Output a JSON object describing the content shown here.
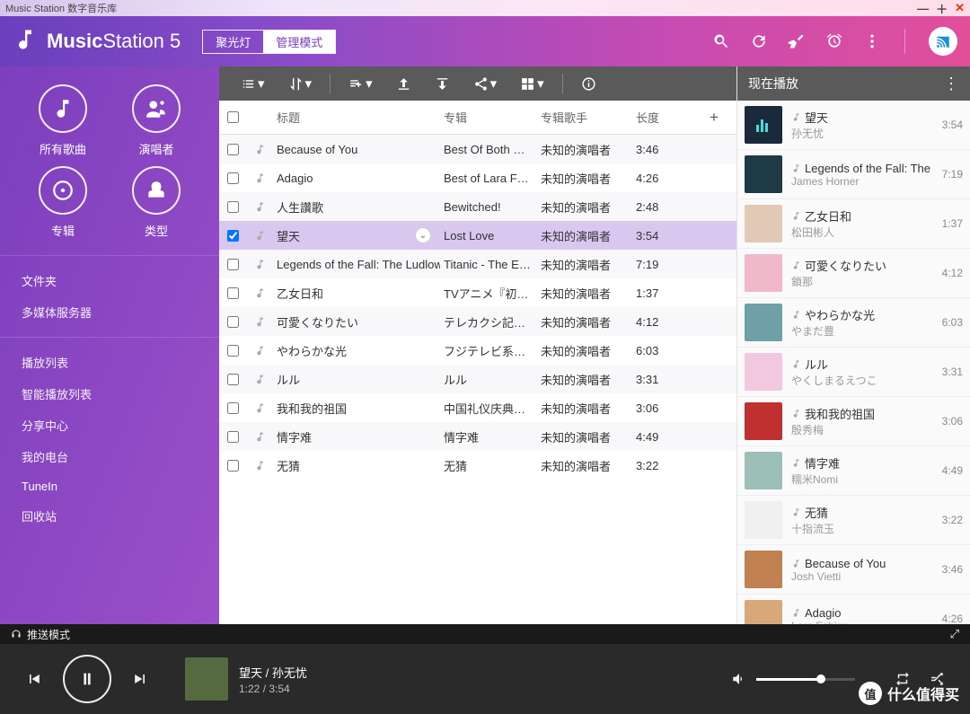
{
  "window": {
    "title": "Music Station 数字音乐库"
  },
  "header": {
    "app_name_bold": "Music",
    "app_name_rest": "Station 5",
    "tab_spotlight": "聚光灯",
    "tab_manage": "管理模式"
  },
  "sidebar": {
    "tiles": [
      {
        "icon": "music",
        "label": "所有歌曲"
      },
      {
        "icon": "artist",
        "label": "演唱者"
      },
      {
        "icon": "album",
        "label": "专辑"
      },
      {
        "icon": "genre",
        "label": "类型"
      }
    ],
    "groups": [
      [
        "文件夹",
        "多媒体服务器"
      ],
      [
        "播放列表",
        "智能播放列表",
        "分享中心",
        "我的电台",
        "TuneIn",
        "回收站"
      ]
    ],
    "active": "TuneIn"
  },
  "table": {
    "headers": {
      "title": "标题",
      "album": "专辑",
      "album_artist": "专辑歌手",
      "length": "长度"
    },
    "rows": [
      {
        "title": "Because of You",
        "album": "Best Of Both Wo...",
        "artist": "未知的演唱者",
        "length": "3:46"
      },
      {
        "title": "Adagio",
        "album": "Best of Lara Fab...",
        "artist": "未知的演唱者",
        "length": "4:26"
      },
      {
        "title": "人生讚歌",
        "album": "Bewitched!",
        "artist": "未知的演唱者",
        "length": "2:48"
      },
      {
        "title": "望天",
        "album": "Lost Love",
        "artist": "未知的演唱者",
        "length": "3:54",
        "selected": true
      },
      {
        "title": "Legends of the Fall: The Ludlows",
        "album": "Titanic - The Ess...",
        "artist": "未知的演唱者",
        "length": "7:19"
      },
      {
        "title": "乙女日和",
        "album": "TVアニメ『初恋...",
        "artist": "未知的演唱者",
        "length": "1:37"
      },
      {
        "title": "可愛くなりたい",
        "album": "テレカクシ記念...",
        "artist": "未知的演唱者",
        "length": "4:12"
      },
      {
        "title": "やわらかな光",
        "album": "フジテレビ系ド...",
        "artist": "未知的演唱者",
        "length": "6:03"
      },
      {
        "title": "ルル",
        "album": "ルル",
        "artist": "未知的演唱者",
        "length": "3:31"
      },
      {
        "title": "我和我的祖国",
        "album": "中国礼仪庆典大...",
        "artist": "未知的演唱者",
        "length": "3:06"
      },
      {
        "title": "情字难",
        "album": "情字难",
        "artist": "未知的演唱者",
        "length": "4:49"
      },
      {
        "title": "无猜",
        "album": "无猜",
        "artist": "未知的演唱者",
        "length": "3:22"
      }
    ]
  },
  "now_playing": {
    "header": "现在播放",
    "items": [
      {
        "title": "望天",
        "artist": "孙无忧",
        "length": "3:54",
        "playing": true
      },
      {
        "title": "Legends of the Fall: The L...",
        "artist": "James Horner",
        "length": "7:19"
      },
      {
        "title": "乙女日和",
        "artist": "松田彬人",
        "length": "1:37"
      },
      {
        "title": "可愛くなりたい",
        "artist": "鎖那",
        "length": "4:12"
      },
      {
        "title": "やわらかな光",
        "artist": "やまだ豊",
        "length": "6:03"
      },
      {
        "title": "ルル",
        "artist": "やくしまるえつこ",
        "length": "3:31"
      },
      {
        "title": "我和我的祖国",
        "artist": "殷秀梅",
        "length": "3:06"
      },
      {
        "title": "情字难",
        "artist": "糯米Nomi",
        "length": "4:49"
      },
      {
        "title": "无猜",
        "artist": "十指流玉",
        "length": "3:22"
      },
      {
        "title": "Because of You",
        "artist": "Josh Vietti",
        "length": "3:46"
      },
      {
        "title": "Adagio",
        "artist": "Lara Fabian",
        "length": "4:26"
      }
    ]
  },
  "pushbar": {
    "label": "推送模式"
  },
  "player": {
    "title": "望天 / 孙无忧",
    "time": "1:22 / 3:54"
  },
  "watermark": {
    "text": "什么值得买",
    "badge": "值"
  },
  "colors": {
    "np_thumbs": [
      "#1a2a3a",
      "#1e3a44",
      "#e2c9b6",
      "#f0b8c8",
      "#6fa0a8",
      "#f2c8e0",
      "#c03030",
      "#9cc0b8",
      "#f0f0f0",
      "#c08050",
      "#d8a878"
    ]
  }
}
